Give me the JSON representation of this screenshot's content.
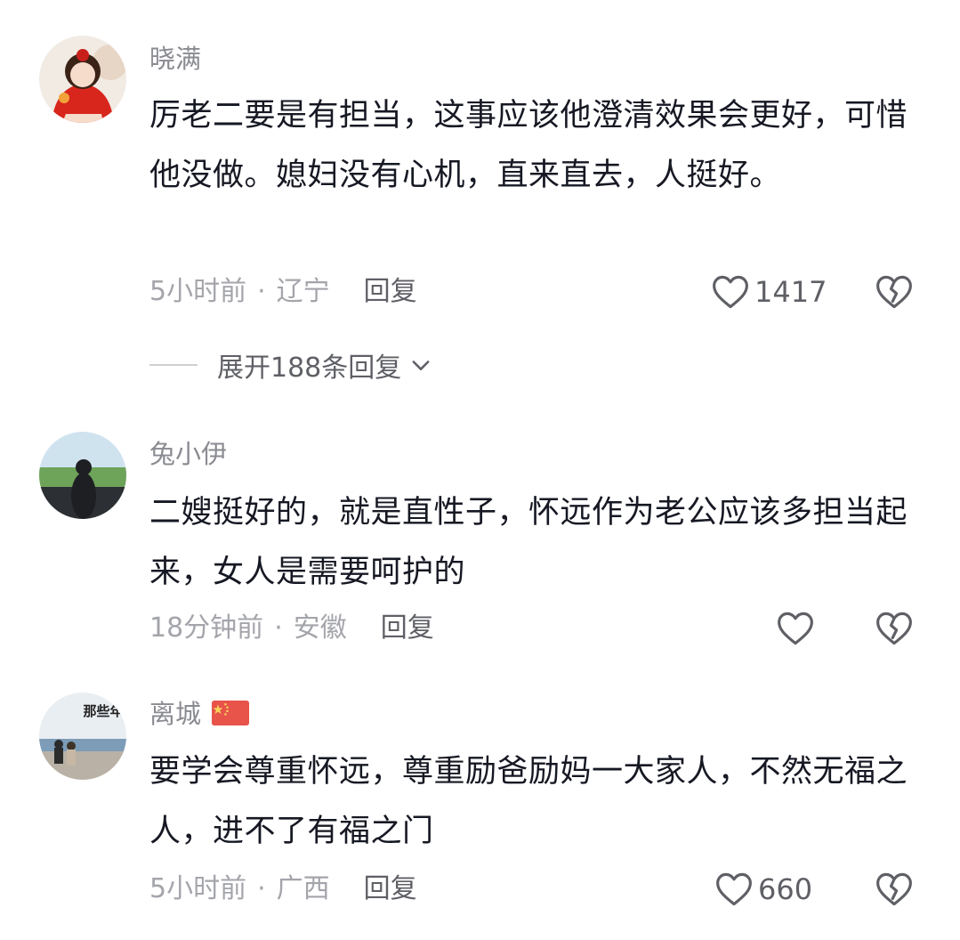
{
  "comments": [
    {
      "username": "晓满",
      "content": "厉老二要是有担当，这事应该他澄清效果会更好，可惜他没做。媳妇没有心机，直来直去，人挺好。",
      "time": "5小时前",
      "location": "辽宁",
      "reply_label": "回复",
      "like_count": "1417",
      "expand_replies": "展开188条回复"
    },
    {
      "username": "兔小伊",
      "content": "二嫂挺好的，就是直性子，怀远作为老公应该多担当起来，女人是需要呵护的",
      "time": "18分钟前",
      "location": "安徽",
      "reply_label": "回复",
      "like_count": ""
    },
    {
      "username": "离城",
      "content": "要学会尊重怀远，尊重励爸励妈一大家人，不然无福之人，进不了有福之门",
      "time": "5小时前",
      "location": "广西",
      "reply_label": "回复",
      "like_count": "660",
      "avatar_text": "那些年"
    }
  ],
  "separator": "·",
  "icons": {
    "like": "heart-outline-icon",
    "dislike": "broken-heart-icon",
    "expand": "chevron-down-icon",
    "flag": "china-flag-icon"
  },
  "colors": {
    "username": "#8a8b91",
    "content": "#161823",
    "meta": "#a4a5ab",
    "action": "#5f6066"
  }
}
